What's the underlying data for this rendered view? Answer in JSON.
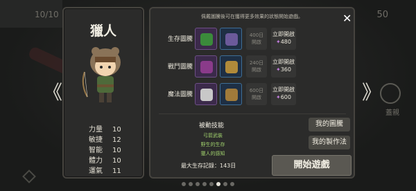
{
  "background": {
    "counter_left": "10/10",
    "counter_right": "50",
    "right_button_label": "蓋親"
  },
  "nav": {
    "prev_glyph": "《",
    "next_glyph": "》"
  },
  "character": {
    "name": "獵人",
    "stats": [
      {
        "label": "力量",
        "value": "10"
      },
      {
        "label": "敏捷",
        "value": "12"
      },
      {
        "label": "智能",
        "value": "10"
      },
      {
        "label": "體力",
        "value": "10"
      },
      {
        "label": "運氣",
        "value": "11"
      }
    ]
  },
  "info": {
    "notice": "佩戴圖騰後可在獲得更多效果的狀態開始遊戲。",
    "close_glyph": "✕",
    "totems": [
      {
        "label": "生存圖騰",
        "locked_days": "400日",
        "locked_text": "開啟",
        "unlock_label": "立即開啟",
        "cost": "480",
        "color_a": "#3b8a3b",
        "color_b": "#6b5a9a"
      },
      {
        "label": "戰鬥圖騰",
        "locked_days": "240日",
        "locked_text": "開啟",
        "unlock_label": "立即開啟",
        "cost": "360",
        "color_a": "#8a3b8a",
        "color_b": "#b08a3a"
      },
      {
        "label": "魔法圖騰",
        "locked_days": "600日",
        "locked_text": "開啟",
        "unlock_label": "立即開啟",
        "cost": "600",
        "color_a": "#c8c8c8",
        "color_b": "#a07a3a"
      }
    ],
    "passive_title": "被動技能",
    "passive_skills": [
      "弓箭武裝",
      "野生的生存",
      "獵人的感知"
    ],
    "record_label": "最大生存記錄：",
    "record_value": "143日",
    "my_totem_button": "我的圖騰",
    "my_craft_button": "我的製作法",
    "start_button": "開始遊戲"
  },
  "pagination": {
    "total": 8,
    "active_index": 5
  }
}
